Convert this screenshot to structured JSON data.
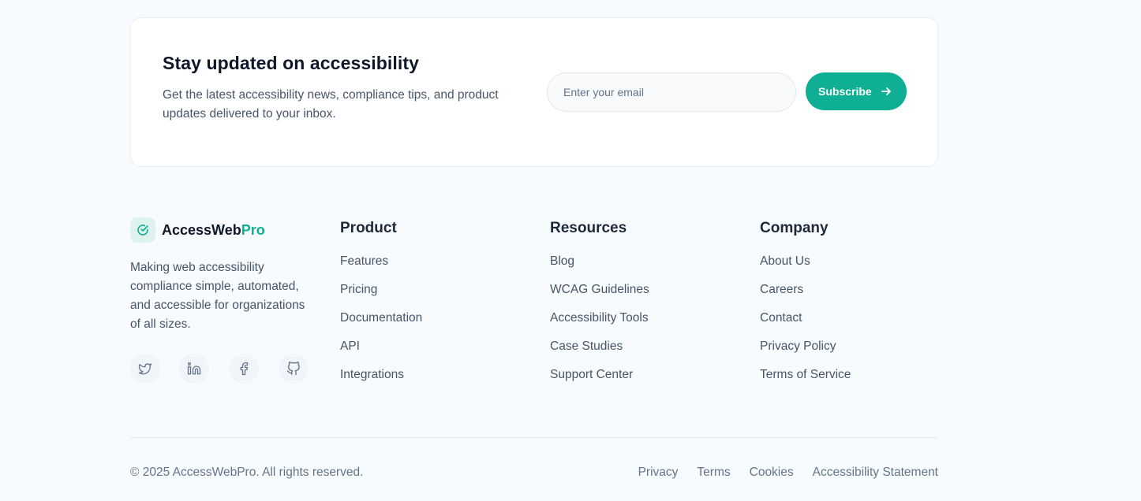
{
  "newsletter": {
    "title": "Stay updated on accessibility",
    "description": "Get the latest accessibility news, compliance tips, and product updates delivered to your inbox.",
    "email_placeholder": "Enter your email",
    "subscribe_label": "Subscribe"
  },
  "brand": {
    "name_primary": "AccessWeb",
    "name_accent": "Pro",
    "description": "Making web accessibility compliance simple, automated, and accessible for organizations of all sizes.",
    "accent_color": "#0eaf92",
    "socials": [
      "twitter-icon",
      "linkedin-icon",
      "facebook-icon",
      "github-icon"
    ]
  },
  "columns": [
    {
      "title": "Product",
      "links": [
        "Features",
        "Pricing",
        "Documentation",
        "API",
        "Integrations"
      ]
    },
    {
      "title": "Resources",
      "links": [
        "Blog",
        "WCAG Guidelines",
        "Accessibility Tools",
        "Case Studies",
        "Support Center"
      ]
    },
    {
      "title": "Company",
      "links": [
        "About Us",
        "Careers",
        "Contact",
        "Privacy Policy",
        "Terms of Service"
      ]
    }
  ],
  "bottom": {
    "copyright": "© 2025 AccessWebPro. All rights reserved.",
    "links": [
      "Privacy",
      "Terms",
      "Cookies",
      "Accessibility Statement"
    ]
  }
}
